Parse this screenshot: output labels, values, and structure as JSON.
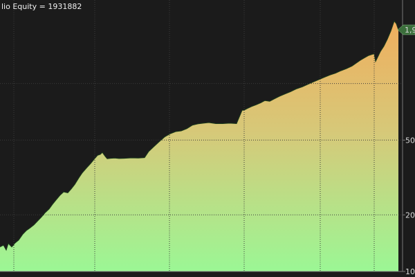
{
  "chart_data": {
    "type": "area",
    "title": "lio Equity = 1931882",
    "y_scale": "log",
    "ylim": [
      100000,
      2600000
    ],
    "y_tick_labels": [
      {
        "value": 1000000,
        "label": "1,9"
      },
      {
        "value": 500000,
        "label": "50"
      },
      {
        "value": 200000,
        "label": "20"
      },
      {
        "value": 100000,
        "label": "10"
      }
    ],
    "last_value_label": "1,9",
    "series": [
      {
        "x": [
          0,
          5,
          9,
          12,
          17,
          22,
          27,
          33,
          38,
          43,
          49,
          54,
          60,
          65,
          71,
          76,
          81,
          87,
          92,
          98,
          103,
          108,
          114,
          119,
          125,
          131,
          136,
          141,
          145,
          148,
          152,
          155,
          160,
          166,
          172,
          180,
          190,
          200,
          209,
          215,
          222,
          230,
          238,
          246,
          254,
          262,
          270,
          278,
          286,
          294,
          302,
          312,
          322,
          332,
          342,
          350,
          353,
          358,
          364,
          370,
          377,
          383,
          390,
          397,
          404,
          412,
          420,
          428,
          437,
          445,
          453,
          461,
          469,
          477,
          485,
          493,
          501,
          509,
          515,
          521,
          527,
          533,
          538,
          541,
          543,
          546,
          550,
          555,
          560,
          565,
          570,
          573,
          576
        ],
        "values": [
          135000,
          138000,
          130000,
          141000,
          135000,
          142000,
          147000,
          158000,
          165000,
          170000,
          177000,
          185000,
          195000,
          205000,
          215000,
          228000,
          240000,
          255000,
          265000,
          262000,
          275000,
          290000,
          315000,
          335000,
          355000,
          375000,
          395000,
          415000,
          420000,
          430000,
          410000,
          398000,
          400000,
          401000,
          399000,
          400000,
          402000,
          401000,
          403000,
          435000,
          460000,
          490000,
          520000,
          540000,
          555000,
          560000,
          575000,
          600000,
          610000,
          615000,
          620000,
          612000,
          612000,
          615000,
          612000,
          720000,
          722000,
          738000,
          755000,
          770000,
          790000,
          812000,
          805000,
          830000,
          855000,
          880000,
          905000,
          935000,
          960000,
          990000,
          1020000,
          1050000,
          1080000,
          1110000,
          1135000,
          1170000,
          1200000,
          1240000,
          1285000,
          1330000,
          1370000,
          1410000,
          1430000,
          1440000,
          1310000,
          1380000,
          1480000,
          1580000,
          1720000,
          1900000,
          2150000,
          2080000,
          1931882
        ]
      }
    ],
    "colors": {
      "background": "#1b1b1b",
      "fill_top": "#f0ae5e",
      "fill_bottom": "#9bf795",
      "line": "#1a3a1a",
      "grid": "#3b3b3b",
      "badge": "#3b6e3b"
    },
    "x_grid": [
      20,
      137,
      245,
      353,
      463,
      541
    ],
    "grid": true
  }
}
